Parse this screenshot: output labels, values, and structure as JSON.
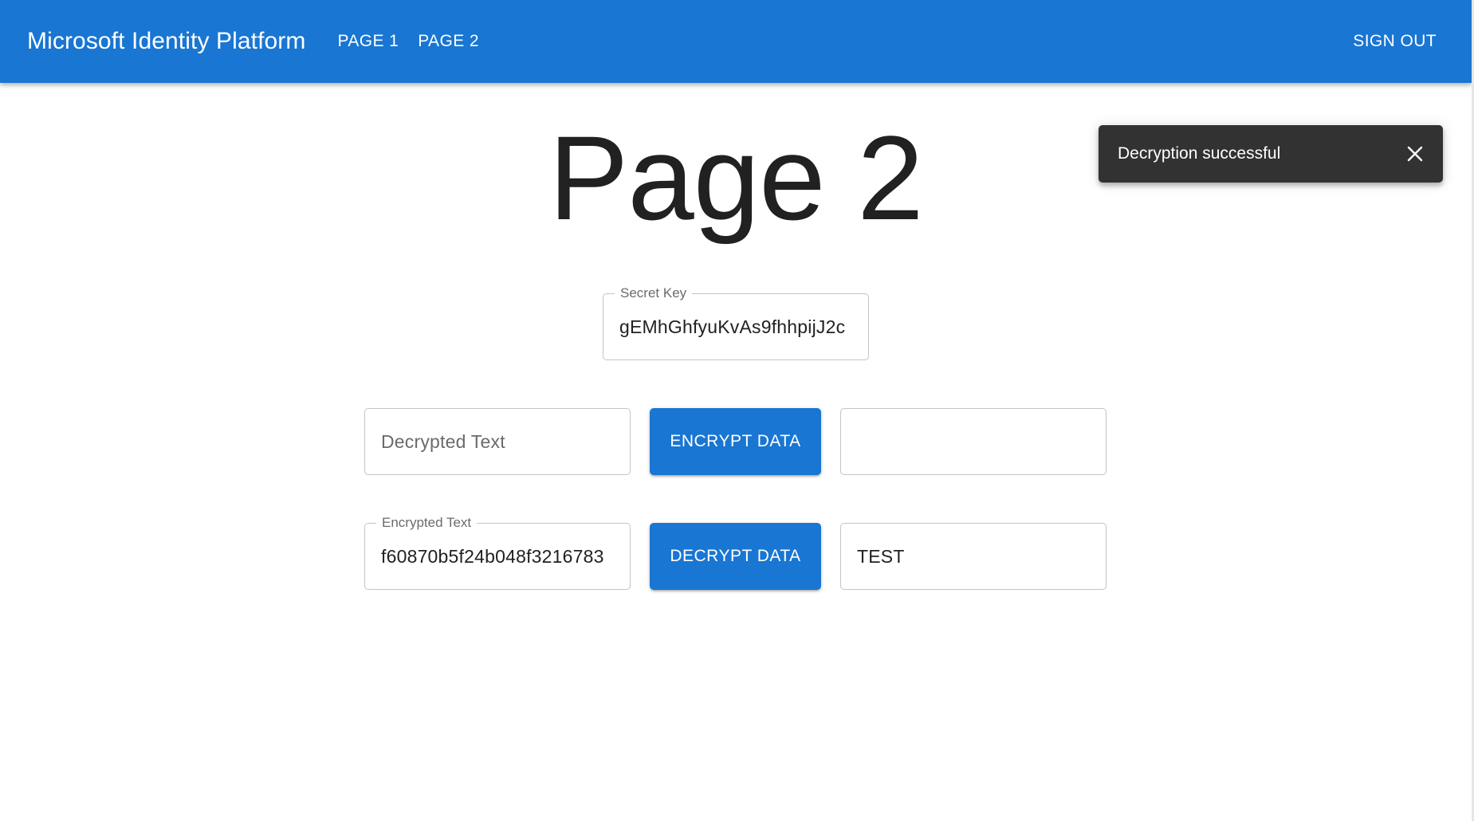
{
  "appbar": {
    "title": "Microsoft Identity Platform",
    "nav": [
      {
        "label": "PAGE 1"
      },
      {
        "label": "PAGE 2"
      }
    ],
    "signout_label": "SIGN OUT",
    "color": "#1976d2"
  },
  "page": {
    "title": "Page 2"
  },
  "secret_key": {
    "label": "Secret Key",
    "value": "gEMhGhfyuKvAs9fhhpijJ2c"
  },
  "encrypt_row": {
    "input_placeholder": "Decrypted Text",
    "button_label": "ENCRYPT DATA",
    "output_value": ""
  },
  "decrypt_row": {
    "input_label": "Encrypted Text",
    "input_value": "f60870b5f24b048f3216783",
    "button_label": "DECRYPT DATA",
    "output_value": "TEST"
  },
  "snackbar": {
    "message": "Decryption successful",
    "close_icon": "close-icon"
  }
}
